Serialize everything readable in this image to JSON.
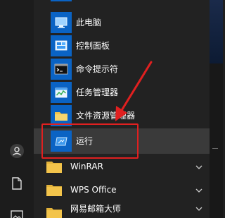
{
  "start_menu": {
    "items": [
      {
        "label": "此电脑",
        "icon": "this-pc-icon"
      },
      {
        "label": "控制面板",
        "icon": "control-panel-icon"
      },
      {
        "label": "命令提示符",
        "icon": "command-prompt-icon"
      },
      {
        "label": "任务管理器",
        "icon": "task-manager-icon"
      },
      {
        "label": "文件资源管理器",
        "icon": "file-explorer-icon"
      },
      {
        "label": "运行",
        "icon": "run-icon"
      },
      {
        "label": "WinRAR",
        "icon": "folder-icon"
      },
      {
        "label": "WPS Office",
        "icon": "folder-icon"
      },
      {
        "label": "网易邮箱大师",
        "icon": "folder-icon"
      }
    ],
    "selected_index": 5
  },
  "left_rail": {
    "icons": [
      "user-icon",
      "documents-icon",
      "pictures-icon"
    ]
  },
  "colors": {
    "accent_tile": "#0a63c4",
    "highlight_red": "#e02020",
    "folder_yellow": "#f3c44b"
  }
}
